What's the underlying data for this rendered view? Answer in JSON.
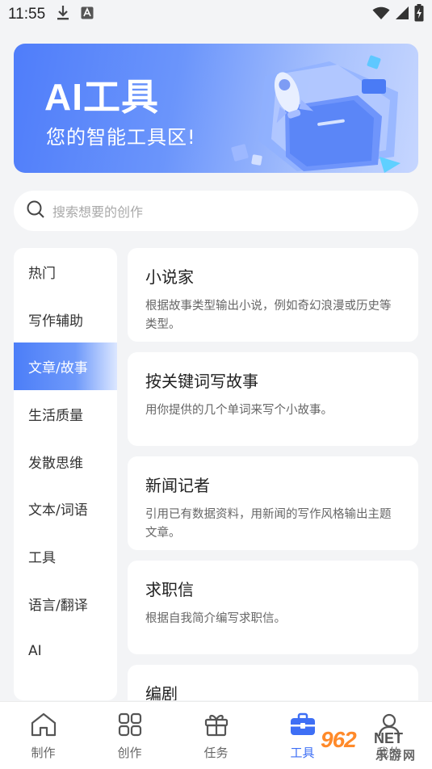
{
  "status_bar": {
    "time": "11:55",
    "icons_left": [
      "download-icon",
      "a-icon"
    ],
    "icons_right": [
      "wifi-icon",
      "signal-icon",
      "battery-charging-icon"
    ]
  },
  "banner": {
    "title": "AI工具",
    "subtitle": "您的智能工具区!"
  },
  "search": {
    "placeholder": "搜索想要的创作"
  },
  "sidebar": {
    "active_index": 2,
    "items": [
      {
        "label": "热门"
      },
      {
        "label": "写作辅助"
      },
      {
        "label": "文章/故事"
      },
      {
        "label": "生活质量"
      },
      {
        "label": "发散思维"
      },
      {
        "label": "文本/词语"
      },
      {
        "label": "工具"
      },
      {
        "label": "语言/翻译"
      },
      {
        "label": "AI"
      }
    ]
  },
  "cards": [
    {
      "title": "小说家",
      "desc": "根据故事类型输出小说，例如奇幻浪漫或历史等类型。"
    },
    {
      "title": "按关键词写故事",
      "desc": "用你提供的几个单词来写个小故事。"
    },
    {
      "title": "新闻记者",
      "desc": "引用已有数据资料，用新闻的写作风格输出主题文章。"
    },
    {
      "title": "求职信",
      "desc": "根据自我简介编写求职信。"
    },
    {
      "title": "编剧",
      "desc": ""
    }
  ],
  "bottom_nav": {
    "active_index": 3,
    "items": [
      {
        "label": "制作",
        "icon": "house-icon"
      },
      {
        "label": "创作",
        "icon": "grid-icon"
      },
      {
        "label": "任务",
        "icon": "gift-icon"
      },
      {
        "label": "工具",
        "icon": "toolbox-icon"
      },
      {
        "label": "我的",
        "icon": "user-icon"
      }
    ]
  },
  "watermark": {
    "number": "962",
    "suffix": "NET",
    "text": "乐游网"
  },
  "colors": {
    "accent": "#3e6ff5",
    "background": "#f3f4f6",
    "card": "#ffffff",
    "banner_start": "#4f7dfa",
    "banner_end": "#c6d6ff"
  }
}
